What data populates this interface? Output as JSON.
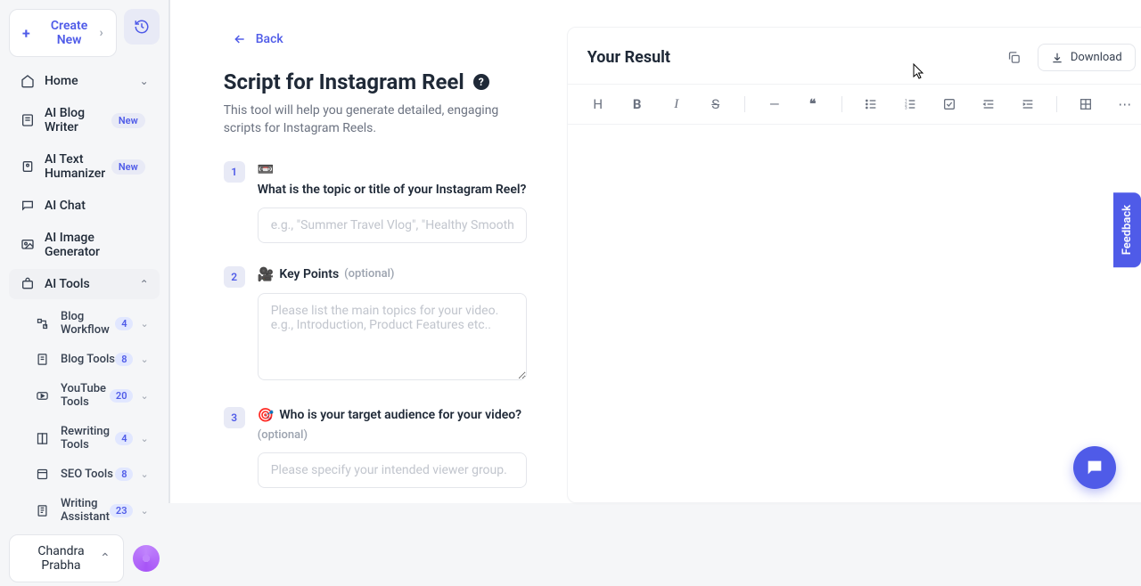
{
  "sidebar": {
    "create_label": "Create New",
    "items": [
      {
        "label": "Home"
      },
      {
        "label": "AI Blog Writer",
        "badge": "New"
      },
      {
        "label": "AI Text Humanizer",
        "badge": "New"
      },
      {
        "label": "AI Chat"
      },
      {
        "label": "AI Image Generator"
      },
      {
        "label": "AI Tools"
      }
    ],
    "sub_items": [
      {
        "label": "Blog Workflow",
        "count": "4"
      },
      {
        "label": "Blog Tools",
        "count": "8"
      },
      {
        "label": "YouTube Tools",
        "count": "20"
      },
      {
        "label": "Rewriting Tools",
        "count": "4"
      },
      {
        "label": "SEO Tools",
        "count": "8"
      },
      {
        "label": "Writing Assistant",
        "count": "23"
      }
    ],
    "user_name": "Chandra Prabha"
  },
  "form": {
    "back_label": "Back",
    "title": "Script for Instagram Reel",
    "description": "This tool will help you generate detailed, engaging scripts for Instagram Reels.",
    "fields": [
      {
        "num": "1",
        "emoji": "📼",
        "label": "What is the topic or title of your Instagram Reel?",
        "placeholder": "e.g., \"Summer Travel Vlog\", \"Healthy Smoothie Recipe\""
      },
      {
        "num": "2",
        "emoji": "🎥",
        "label": "Key Points",
        "optional": "(optional)",
        "placeholder": "Please list the main topics for your video. e.g., Introduction, Product Features etc.."
      },
      {
        "num": "3",
        "emoji": "🎯",
        "label": "Who is your target audience for your video?",
        "optional": "(optional)",
        "placeholder": "Please specify your intended viewer group.  e.g., Your"
      }
    ]
  },
  "result": {
    "title": "Your Result",
    "download_label": "Download"
  },
  "feedback_label": "Feedback"
}
